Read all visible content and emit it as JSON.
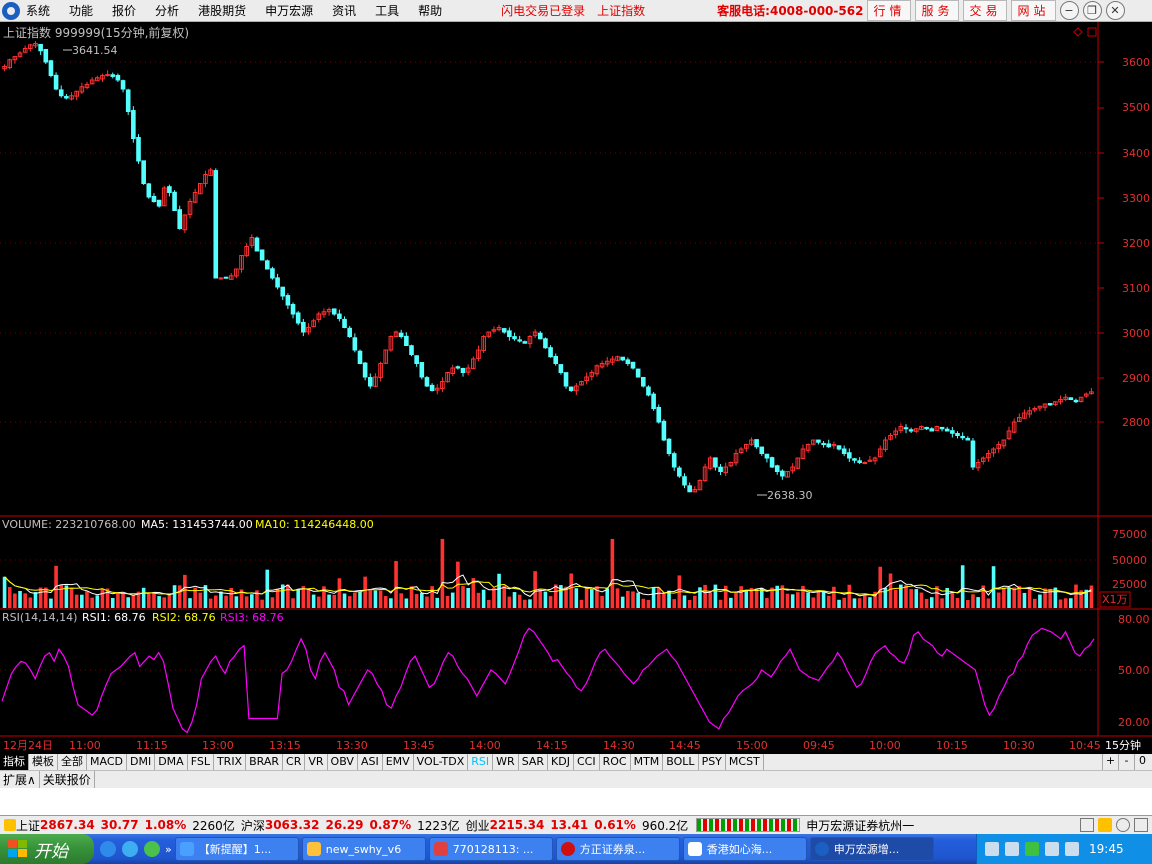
{
  "menubar": {
    "items": [
      "系统",
      "功能",
      "报价",
      "分析",
      "港股期货",
      "申万宏源",
      "资讯",
      "工具",
      "帮助"
    ],
    "notice": "闪电交易已登录",
    "notice_index": "上证指数",
    "hotline": "客服电话:4008-000-562",
    "buttons": [
      "行情",
      "服务",
      "交易",
      "网站"
    ],
    "window_controls": [
      "minimize-icon",
      "restore-icon",
      "close-icon"
    ]
  },
  "main_chart": {
    "title": "上证指数 999999(15分钟,前复权)",
    "high_label": "3641.54",
    "low_label": "2638.30",
    "y_ticks": [
      "3600",
      "3500",
      "3400",
      "3300",
      "3200",
      "3100",
      "3000",
      "2900",
      "2800"
    ]
  },
  "volume_panel": {
    "label": "VOLUME: 223210768.00",
    "ma5": "MA5: 131453744.00",
    "ma10": "MA10: 114246448.00",
    "y_ticks": [
      "75000",
      "50000",
      "25000"
    ],
    "unit": "X1万"
  },
  "rsi_panel": {
    "label": "RSI(14,14,14)",
    "rsi1": "RSI1: 68.76",
    "rsi2": "RSI2: 68.76",
    "rsi3": "RSI3: 68.76",
    "y_ticks": [
      "80.00",
      "50.00",
      "20.00"
    ]
  },
  "time_axis": {
    "labels": [
      "12月24日",
      "11:00",
      "11:15",
      "13:00",
      "13:15",
      "13:30",
      "13:45",
      "14:00",
      "14:15",
      "14:30",
      "14:45",
      "15:00",
      "09:45",
      "10:00",
      "10:15",
      "10:30",
      "10:45"
    ],
    "period": "15分钟"
  },
  "indicator_tabs": [
    "指标",
    "模板",
    "全部",
    "MACD",
    "DMI",
    "DMA",
    "FSL",
    "TRIX",
    "BRAR",
    "CR",
    "VR",
    "OBV",
    "ASI",
    "EMV",
    "VOL-TDX",
    "RSI",
    "WR",
    "SAR",
    "KDJ",
    "CCI",
    "ROC",
    "MTM",
    "BOLL",
    "PSY",
    "MCST"
  ],
  "active_indicator": "RSI",
  "tab_controls": [
    "+",
    "-",
    "0"
  ],
  "extension_tabs": [
    "扩展∧",
    "关联报价"
  ],
  "status": {
    "sh_label": "上证",
    "sh_value": "2867.34",
    "sh_change": "30.77",
    "sh_pct": "1.08%",
    "sh_amount": "2260亿",
    "hs_label": "沪深",
    "hs_value": "3063.32",
    "hs_change": "26.29",
    "hs_pct": "0.87%",
    "hs_amount": "1223亿",
    "cy_label": "创业",
    "cy_value": "2215.34",
    "cy_change": "13.41",
    "cy_pct": "0.61%",
    "cy_amount": "960.2亿",
    "broker": "申万宏源证券杭州一"
  },
  "taskbar": {
    "start": "开始",
    "tasks": [
      "【新提醒】1...",
      "new_swhy_v6",
      "770128113: ...",
      "方正证券泉...",
      "香港如心海...",
      "申万宏源增..."
    ],
    "clock": "19:45"
  },
  "colors": {
    "up": "#ff3232",
    "down": "#54ffff",
    "axis": "#c00000",
    "ma5": "#ffffff",
    "ma10": "#ffff00",
    "rsi": "#ff00ff"
  },
  "chart_data": {
    "type": "candlestick",
    "title": "上证指数 999999(15分钟,前复权)",
    "y_range": [
      2600,
      3700
    ],
    "close_path": [
      3590,
      3605,
      3612,
      3620,
      3630,
      3638,
      3641,
      3625,
      3600,
      3570,
      3540,
      3525,
      3520,
      3525,
      3535,
      3545,
      3550,
      3560,
      3565,
      3570,
      3572,
      3568,
      3560,
      3540,
      3490,
      3430,
      3380,
      3330,
      3300,
      3290,
      3280,
      3320,
      3310,
      3270,
      3230,
      3260,
      3290,
      3310,
      3330,
      3350,
      3360,
      3120,
      3120,
      3120,
      3125,
      3140,
      3170,
      3190,
      3210,
      3180,
      3160,
      3140,
      3120,
      3100,
      3080,
      3060,
      3040,
      3020,
      3000,
      3010,
      3025,
      3040,
      3045,
      3050,
      3040,
      3030,
      3010,
      2990,
      2960,
      2930,
      2900,
      2880,
      2900,
      2930,
      2960,
      2990,
      3000,
      2990,
      2970,
      2950,
      2930,
      2900,
      2880,
      2870,
      2875,
      2890,
      2910,
      2920,
      2920,
      2910,
      2920,
      2940,
      2960,
      2990,
      3000,
      3005,
      3010,
      3000,
      2990,
      2985,
      2980,
      2975,
      2990,
      3000,
      2985,
      2965,
      2945,
      2930,
      2910,
      2880,
      2870,
      2880,
      2890,
      2900,
      2910,
      2925,
      2930,
      2935,
      2940,
      2945,
      2938,
      2930,
      2920,
      2900,
      2880,
      2860,
      2830,
      2800,
      2760,
      2730,
      2700,
      2680,
      2660,
      2645,
      2650,
      2670,
      2700,
      2720,
      2700,
      2690,
      2700,
      2710,
      2730,
      2740,
      2750,
      2760,
      2745,
      2730,
      2720,
      2700,
      2690,
      2680,
      2690,
      2700,
      2720,
      2740,
      2750,
      2760,
      2755,
      2750,
      2745,
      2750,
      2740,
      2730,
      2720,
      2715,
      2710,
      2710,
      2715,
      2720,
      2740,
      2760,
      2770,
      2780,
      2790,
      2785,
      2780,
      2785,
      2790,
      2785,
      2780,
      2790,
      2785,
      2780,
      2775,
      2770,
      2765,
      2760,
      2700,
      2710,
      2720,
      2730,
      2740,
      2750,
      2760,
      2780,
      2800,
      2810,
      2820,
      2825,
      2830,
      2835,
      2840,
      2838,
      2845,
      2850,
      2855,
      2850,
      2845,
      2855,
      2862,
      2867
    ],
    "volume_y_range": [
      0,
      90000
    ],
    "rsi_y_range": [
      10,
      85
    ],
    "rsi_path": [
      32,
      40,
      48,
      52,
      55,
      54,
      50,
      45,
      52,
      58,
      60,
      55,
      62,
      58,
      52,
      40,
      30,
      28,
      26,
      24,
      27,
      35,
      42,
      48,
      50,
      52,
      55,
      58,
      60,
      52,
      55,
      58,
      56,
      60,
      55,
      42,
      28,
      22,
      16,
      14,
      20,
      30,
      45,
      50,
      55,
      58,
      52,
      48,
      55,
      58,
      62,
      64,
      22,
      22,
      22,
      22,
      22,
      22,
      22,
      48,
      50,
      55,
      62,
      68,
      62,
      50,
      45,
      55,
      60,
      55,
      50,
      40,
      38,
      30,
      35,
      40,
      45,
      50,
      48,
      42,
      38,
      30,
      28,
      35,
      40,
      48,
      55,
      58,
      52,
      46,
      40,
      42,
      48,
      55,
      60,
      58,
      52,
      48,
      45,
      40,
      35,
      40,
      45,
      50,
      48,
      45,
      42,
      48,
      55,
      62,
      70,
      74,
      72,
      68,
      64,
      60,
      55,
      56,
      52,
      48,
      45,
      40,
      38,
      42,
      48,
      55,
      60,
      62,
      58,
      55,
      52,
      48,
      45,
      42,
      45,
      50,
      52,
      55,
      58,
      60,
      62,
      58,
      55,
      50,
      45,
      40,
      35,
      30,
      25,
      20,
      18,
      16,
      22,
      25,
      30,
      35,
      38,
      40,
      42,
      45,
      50,
      48,
      46,
      50,
      55,
      58,
      62,
      56,
      50,
      48,
      46,
      45,
      44,
      48,
      52,
      55,
      60,
      56,
      50,
      45,
      40,
      42,
      48,
      55,
      60,
      62,
      64,
      60,
      58,
      55,
      54,
      60,
      70,
      72,
      68,
      66,
      64,
      60,
      58,
      62,
      60,
      58,
      56,
      54,
      52,
      50,
      40,
      30,
      24,
      28,
      35,
      40,
      46,
      48,
      55,
      58,
      65,
      70,
      72,
      74,
      73,
      72,
      70,
      68,
      72,
      66,
      60,
      58,
      62,
      64,
      68
    ]
  }
}
